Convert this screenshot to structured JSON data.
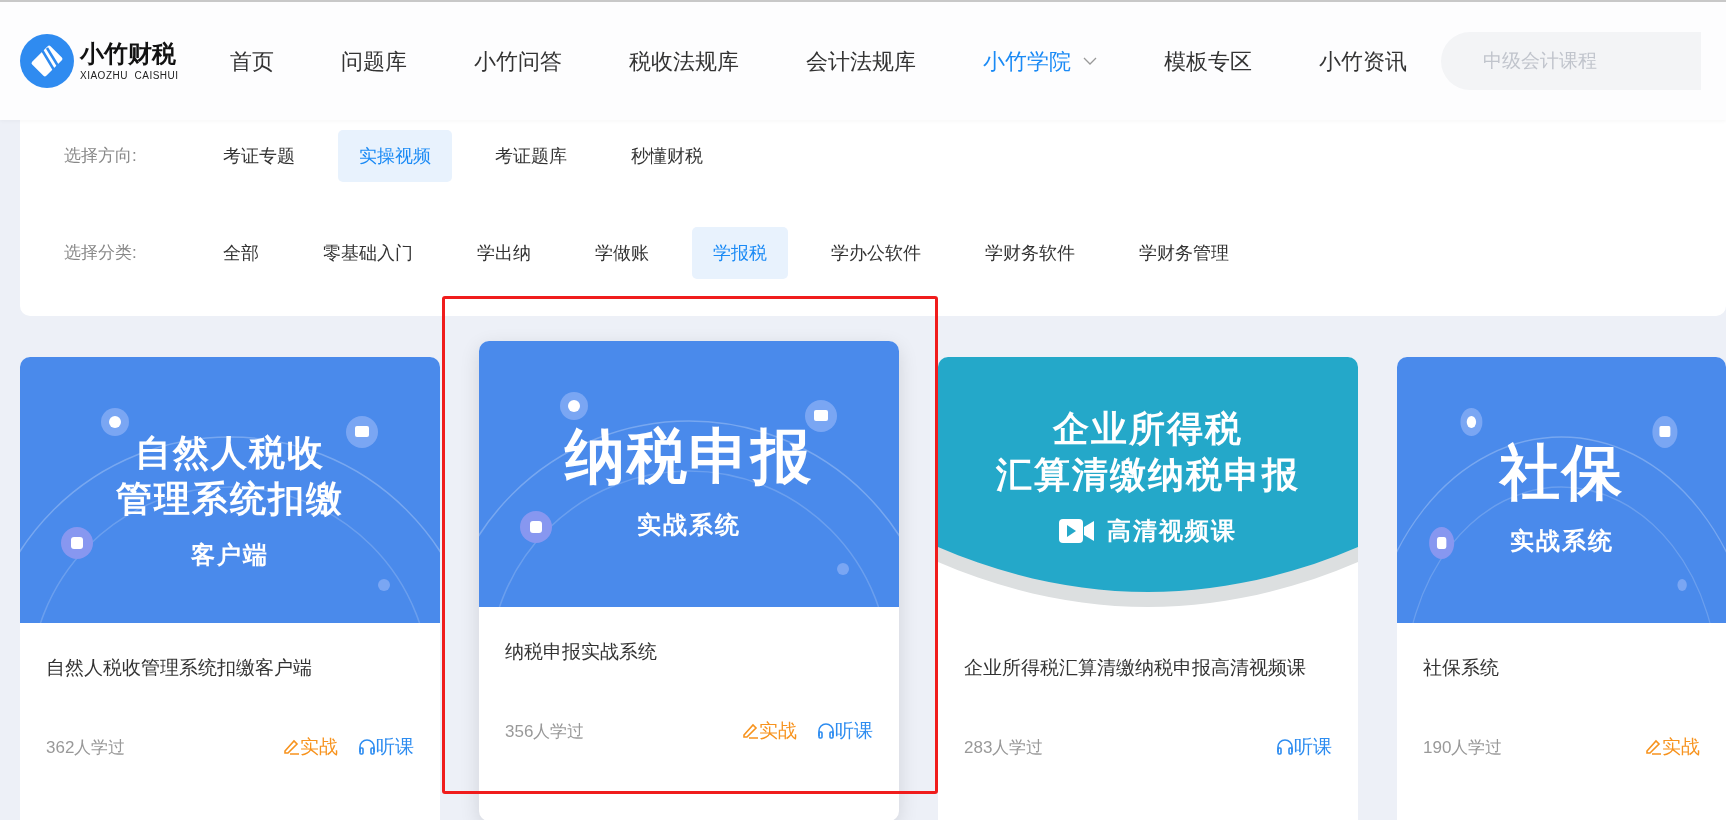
{
  "header": {
    "logo": {
      "name": "小竹财税",
      "subtitle": "XIAOZHU  CAISHUI"
    },
    "nav": [
      {
        "label": "首页",
        "selected": false,
        "dropdown": false
      },
      {
        "label": "问题库",
        "selected": false,
        "dropdown": false
      },
      {
        "label": "小竹问答",
        "selected": false,
        "dropdown": false
      },
      {
        "label": "税收法规库",
        "selected": false,
        "dropdown": false
      },
      {
        "label": "会计法规库",
        "selected": false,
        "dropdown": false
      },
      {
        "label": "小竹学院",
        "selected": true,
        "dropdown": true
      },
      {
        "label": "模板专区",
        "selected": false,
        "dropdown": false
      },
      {
        "label": "小竹资讯",
        "selected": false,
        "dropdown": false
      }
    ],
    "search": {
      "placeholder": "中级会计课程"
    }
  },
  "filters": [
    {
      "label": "选择方向:",
      "options": [
        {
          "label": "考证专题",
          "selected": false
        },
        {
          "label": "实操视频",
          "selected": true
        },
        {
          "label": "考证题库",
          "selected": false
        },
        {
          "label": "秒懂财税",
          "selected": false
        }
      ]
    },
    {
      "label": "选择分类:",
      "options": [
        {
          "label": "全部",
          "selected": false
        },
        {
          "label": "零基础入门",
          "selected": false
        },
        {
          "label": "学出纳",
          "selected": false
        },
        {
          "label": "学做账",
          "selected": false
        },
        {
          "label": "学报税",
          "selected": true
        },
        {
          "label": "学办公软件",
          "selected": false
        },
        {
          "label": "学财务软件",
          "selected": false
        },
        {
          "label": "学财务管理",
          "selected": false
        }
      ]
    }
  ],
  "courses": [
    {
      "banner": {
        "kind": "orbit",
        "title_lines": [
          "自然人税收",
          "管理系统扣缴"
        ],
        "subtitle": "客户端"
      },
      "title": "自然人税收管理系统扣缴客户端",
      "learners": "362人学过",
      "highlighted": false,
      "actions": [
        {
          "kind": "practice",
          "label": "实战"
        },
        {
          "kind": "listen",
          "label": "听课"
        }
      ]
    },
    {
      "banner": {
        "kind": "orbit",
        "title_lines": [
          "纳税申报"
        ],
        "subtitle": "实战系统"
      },
      "title": "纳税申报实战系统",
      "learners": "356人学过",
      "highlighted": true,
      "actions": [
        {
          "kind": "practice",
          "label": "实战"
        },
        {
          "kind": "listen",
          "label": "听课"
        }
      ]
    },
    {
      "banner": {
        "kind": "wave",
        "title_lines": [
          "企业所得税",
          "汇算清缴纳税申报"
        ],
        "subtitle": "高清视频课"
      },
      "title": "企业所得税汇算清缴纳税申报高清视频课",
      "learners": "283人学过",
      "highlighted": false,
      "actions": [
        {
          "kind": "listen",
          "label": "听课"
        }
      ]
    },
    {
      "banner": {
        "kind": "orbit",
        "title_lines": [
          "社保"
        ],
        "subtitle": "实战系统"
      },
      "title": "社保系统",
      "learners": "190人学过",
      "highlighted": false,
      "actions": [
        {
          "kind": "practice",
          "label": "实战"
        }
      ]
    }
  ]
}
